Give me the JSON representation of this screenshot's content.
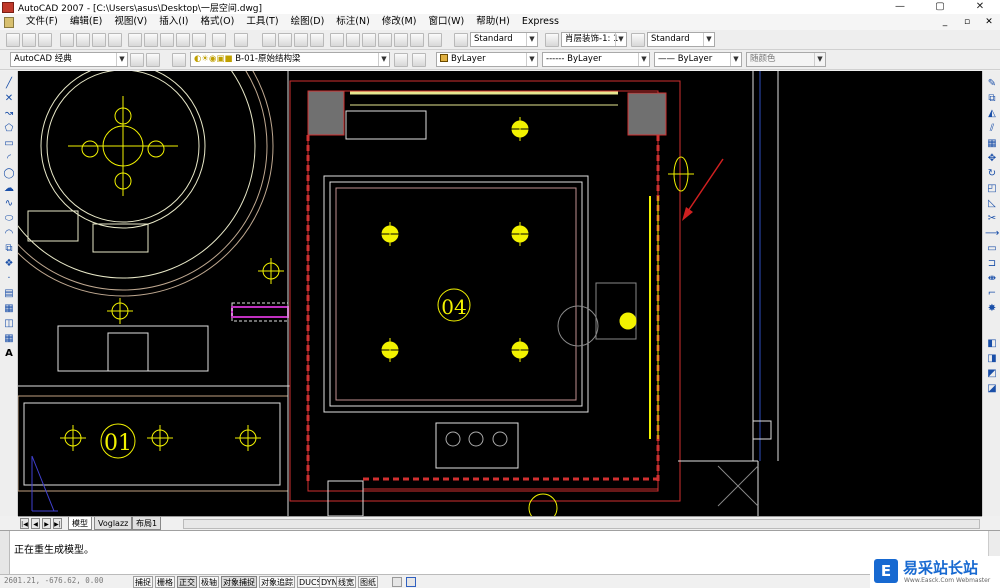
{
  "titlebar": {
    "title": "AutoCAD 2007 - [C:\\Users\\asus\\Desktop\\一层空间.dwg]",
    "minimize": "—",
    "maximize": "▢",
    "close": "✕"
  },
  "menubar": {
    "items": [
      "文件(F)",
      "编辑(E)",
      "视图(V)",
      "插入(I)",
      "格式(O)",
      "工具(T)",
      "绘图(D)",
      "标注(N)",
      "修改(M)",
      "窗口(W)",
      "帮助(H)",
      "Express"
    ],
    "doc_min": "_",
    "doc_restore": "▫",
    "doc_close": "✕"
  },
  "toolbar1": {
    "text_style": "Standard",
    "dim_style": "肖层装饰-1: 1",
    "table_style": "Standard"
  },
  "toolbar2": {
    "workspace": "AutoCAD 经典",
    "layer": "B-01-原始结构梁",
    "color": "ByLayer",
    "linetype": "ByLayer",
    "lineweight": "ByLayer",
    "plotstyle": "随颜色"
  },
  "canvas": {
    "room_label_main": "04",
    "room_label_left": "01",
    "fixture_color": "#f2f200",
    "line_color": "#ffffff",
    "wall_color": "#e03030",
    "arrow_color": "#d02020",
    "column_color": "#707070"
  },
  "layout_tabs": {
    "nav_first": "|◀",
    "nav_prev": "◀",
    "nav_next": "▶",
    "nav_last": "▶|",
    "tabs": [
      "模型",
      "Voglazz",
      "布局1"
    ]
  },
  "command": {
    "text": "正在重生成模型。"
  },
  "statusbar": {
    "coords": "2601.21, -676.62, 0.00",
    "buttons": [
      "捕捉",
      "栅格",
      "正交",
      "极轴",
      "对象捕捉",
      "对象追踪",
      "DUCS",
      "DYN",
      "线宽",
      "图纸"
    ]
  },
  "watermark": {
    "logo": "E",
    "title": "易采站长站",
    "url": "Www.Easck.Com Webmaster"
  }
}
